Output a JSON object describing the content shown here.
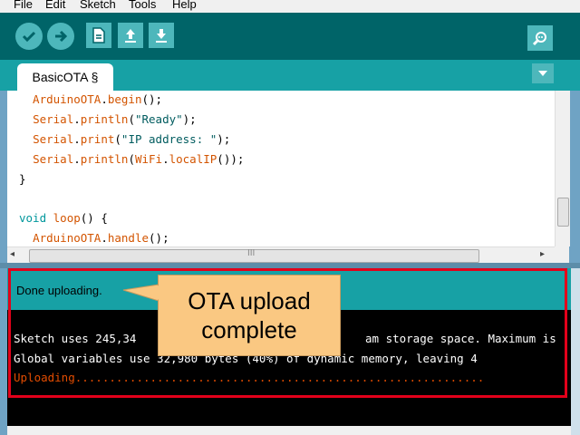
{
  "menu": [
    "File",
    "Edit",
    "Sketch",
    "Tools",
    "Help"
  ],
  "toolbar": {
    "verify_icon": "checkmark-icon",
    "upload_icon": "arrow-right-icon",
    "new_icon": "new-sketch-icon",
    "open_icon": "open-up-arrow-icon",
    "save_icon": "save-down-arrow-icon",
    "monitor_icon": "serial-monitor-icon"
  },
  "tab": {
    "label": "BasicOTA §"
  },
  "editor": {
    "lines": [
      "  ArduinoOTA.begin();",
      "  Serial.println(\"Ready\");",
      "  Serial.print(\"IP address: \");",
      "  Serial.println(WiFi.localIP());",
      "}",
      "",
      "void loop() {",
      "  ArduinoOTA.handle();"
    ],
    "hscroll_marker": "III"
  },
  "status": {
    "text": "Done uploading."
  },
  "console": {
    "lines": [
      "Sketch uses 245,34",
      "Global variables use 32,980 bytes (40%) of dynamic memory, leaving 4",
      "Uploading............................................................"
    ],
    "line1_tail": "am storage space. Maximum is"
  },
  "callout": {
    "line1": "OTA upload",
    "line2": "complete"
  },
  "colors": {
    "toolbar": "#006468",
    "tabstrip": "#17a1a5",
    "button": "#4db7bb",
    "highlight": "#e2001a",
    "callout": "#fac882"
  }
}
